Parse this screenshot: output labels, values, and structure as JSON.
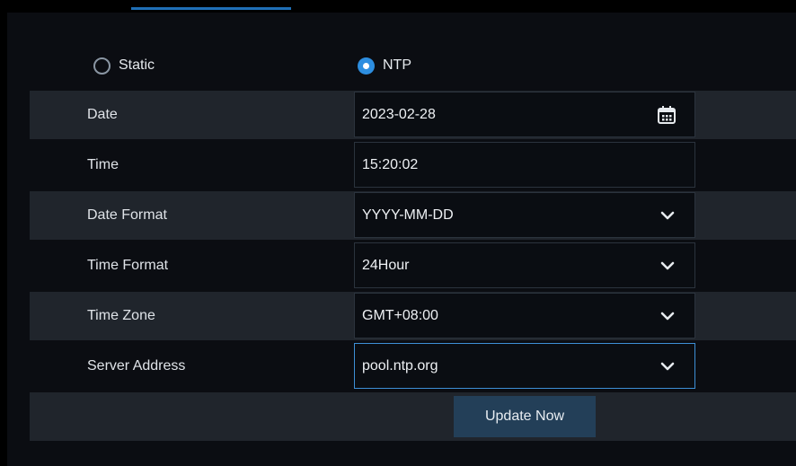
{
  "time_mode": {
    "options": [
      {
        "label": "Static",
        "selected": false
      },
      {
        "label": "NTP",
        "selected": true
      }
    ]
  },
  "fields": {
    "date": {
      "label": "Date",
      "value": "2023-02-28",
      "icon": "calendar-icon"
    },
    "time": {
      "label": "Time",
      "value": "15:20:02"
    },
    "date_format": {
      "label": "Date Format",
      "value": "YYYY-MM-DD",
      "icon": "chevron-down-icon"
    },
    "time_format": {
      "label": "Time Format",
      "value": "24Hour",
      "icon": "chevron-down-icon"
    },
    "time_zone": {
      "label": "Time Zone",
      "value": "GMT+08:00",
      "icon": "chevron-down-icon"
    },
    "server_address": {
      "label": "Server Address",
      "value": "pool.ntp.org",
      "icon": "chevron-down-icon"
    }
  },
  "actions": {
    "update_now_label": "Update Now"
  },
  "colors": {
    "accent": "#2d8ee0",
    "row_shade": "#20252c",
    "button_bg": "#233f58",
    "focus_border": "#3d8fd6"
  }
}
